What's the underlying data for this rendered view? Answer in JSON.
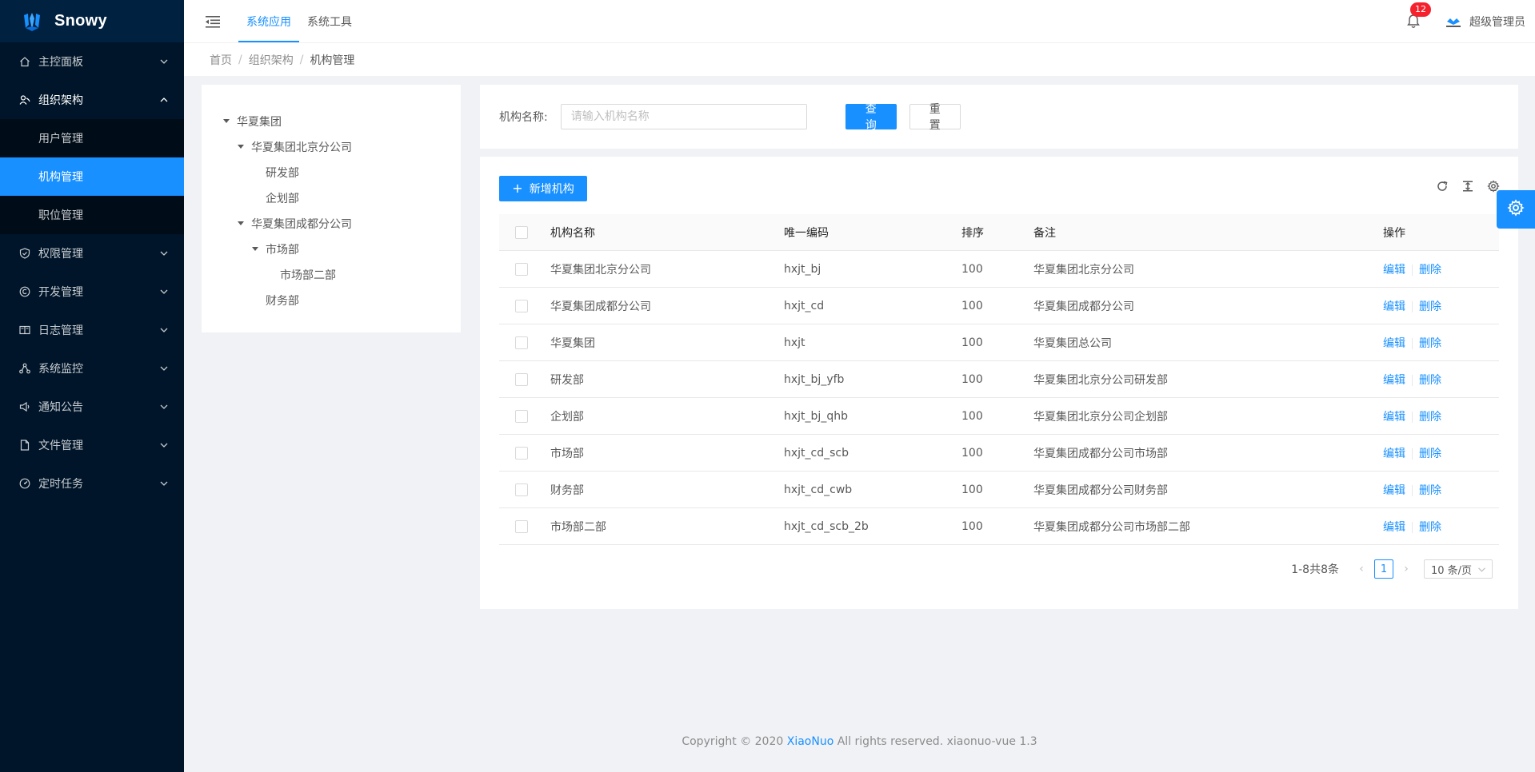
{
  "app": {
    "name": "Snowy",
    "brand_color": "#1890ff"
  },
  "sidebar": {
    "items": [
      {
        "label": "主控面板",
        "icon": "home-icon",
        "open": false
      },
      {
        "label": "组织架构",
        "icon": "org-icon",
        "open": true,
        "children": [
          {
            "label": "用户管理",
            "active": false
          },
          {
            "label": "机构管理",
            "active": true
          },
          {
            "label": "职位管理",
            "active": false
          }
        ]
      },
      {
        "label": "权限管理",
        "icon": "shield-icon",
        "open": false
      },
      {
        "label": "开发管理",
        "icon": "copyright-icon",
        "open": false
      },
      {
        "label": "日志管理",
        "icon": "book-icon",
        "open": false
      },
      {
        "label": "系统监控",
        "icon": "cluster-icon",
        "open": false
      },
      {
        "label": "通知公告",
        "icon": "sound-icon",
        "open": false
      },
      {
        "label": "文件管理",
        "icon": "file-icon",
        "open": false
      },
      {
        "label": "定时任务",
        "icon": "dashboard-icon",
        "open": false
      }
    ]
  },
  "header": {
    "tabs": [
      "系统应用",
      "系统工具"
    ],
    "active_tab": 0,
    "notification_count": "12",
    "username": "超级管理员"
  },
  "breadcrumb": [
    "首页",
    "组织架构",
    "机构管理"
  ],
  "tree": [
    {
      "label": "华夏集团",
      "level": 0,
      "expanded": true
    },
    {
      "label": "华夏集团北京分公司",
      "level": 1,
      "expanded": true
    },
    {
      "label": "研发部",
      "level": 2,
      "expanded": null
    },
    {
      "label": "企划部",
      "level": 2,
      "expanded": null
    },
    {
      "label": "华夏集团成都分公司",
      "level": 1,
      "expanded": true
    },
    {
      "label": "市场部",
      "level": 2,
      "expanded": true
    },
    {
      "label": "市场部二部",
      "level": 3,
      "expanded": null
    },
    {
      "label": "财务部",
      "level": 2,
      "expanded": null
    }
  ],
  "search": {
    "label": "机构名称:",
    "placeholder": "请输入机构名称",
    "value": "",
    "query_label": "查 询",
    "reset_label": "重 置"
  },
  "table": {
    "add_label": "新增机构",
    "columns": [
      "机构名称",
      "唯一编码",
      "排序",
      "备注",
      "操作"
    ],
    "rows": [
      {
        "name": "华夏集团北京分公司",
        "code": "hxjt_bj",
        "sort": "100",
        "remark": "华夏集团北京分公司"
      },
      {
        "name": "华夏集团成都分公司",
        "code": "hxjt_cd",
        "sort": "100",
        "remark": "华夏集团成都分公司"
      },
      {
        "name": "华夏集团",
        "code": "hxjt",
        "sort": "100",
        "remark": "华夏集团总公司"
      },
      {
        "name": "研发部",
        "code": "hxjt_bj_yfb",
        "sort": "100",
        "remark": "华夏集团北京分公司研发部"
      },
      {
        "name": "企划部",
        "code": "hxjt_bj_qhb",
        "sort": "100",
        "remark": "华夏集团北京分公司企划部"
      },
      {
        "name": "市场部",
        "code": "hxjt_cd_scb",
        "sort": "100",
        "remark": "华夏集团成都分公司市场部"
      },
      {
        "name": "财务部",
        "code": "hxjt_cd_cwb",
        "sort": "100",
        "remark": "华夏集团成都分公司财务部"
      },
      {
        "name": "市场部二部",
        "code": "hxjt_cd_scb_2b",
        "sort": "100",
        "remark": "华夏集团成都分公司市场部二部"
      }
    ],
    "edit_label": "编辑",
    "delete_label": "删除"
  },
  "pagination": {
    "total_text": "1-8共8条",
    "current_page": "1",
    "page_size": "10 条/页"
  },
  "footer": {
    "prefix": "Copyright © 2020",
    "brand": "XiaoNuo",
    "suffix": "All rights reserved. xiaonuo-vue 1.3"
  }
}
